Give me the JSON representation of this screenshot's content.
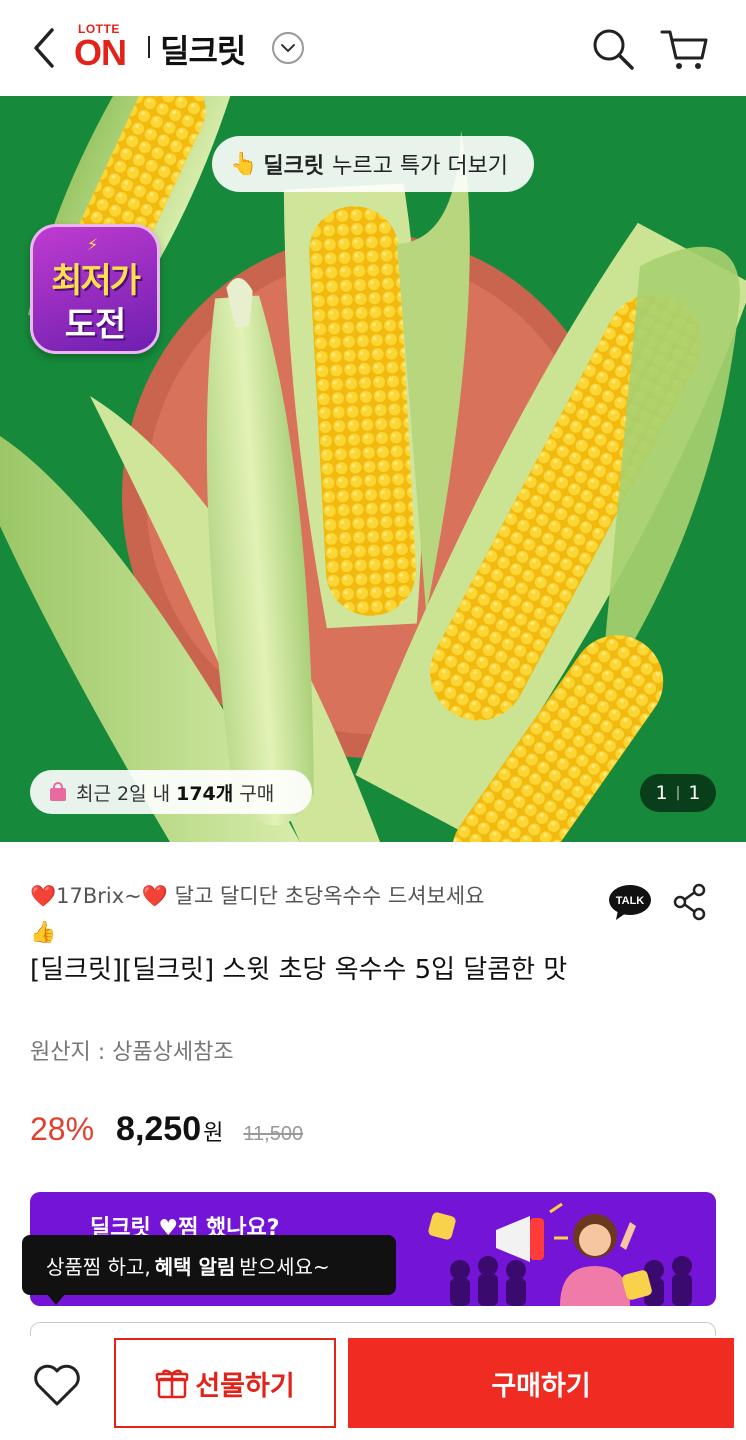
{
  "header": {
    "logo_small": "LOTTE",
    "logo_big": "ON",
    "title": "딜크릿",
    "back_icon": "chevron-left-icon",
    "search_icon": "search-icon",
    "cart_icon": "cart-icon"
  },
  "hero": {
    "badge_line1": "최저가",
    "badge_line2": "도전",
    "top_pill_bold": "딜크릿",
    "top_pill_text": "누르고 특가 더보기",
    "buy_pill_prefix": "최근 2일 내",
    "buy_pill_count": "174개",
    "buy_pill_suffix": "구매",
    "pager_current": "1",
    "pager_total": "1",
    "colors": {
      "background": "#168a3a",
      "plate": "#d9725a",
      "corn": "#f5c518"
    }
  },
  "product": {
    "promo_brix": "17Brix~",
    "promo_text": "달고 달디단 초당옥수수 드셔보세요",
    "title": "[딜크릿][딜크릿] 스윗 초당 옥수수 5입 달콤한 맛",
    "origin": "원산지 : 상품상세참조",
    "discount": "28%",
    "price": "8,250",
    "currency": "원",
    "original_price": "11,500"
  },
  "banner": {
    "text": "딜크릿 ♥찜 했나요?",
    "tooltip_prefix": "상품찜 하고,",
    "tooltip_bold": "혜택 알림",
    "tooltip_suffix": "받으세요~",
    "color": "#7414d6"
  },
  "bottom_bar": {
    "gift_label": "선물하기",
    "buy_label": "구매하기",
    "accent": "#ef2b22"
  },
  "share": {
    "talk_label": "TALK"
  }
}
